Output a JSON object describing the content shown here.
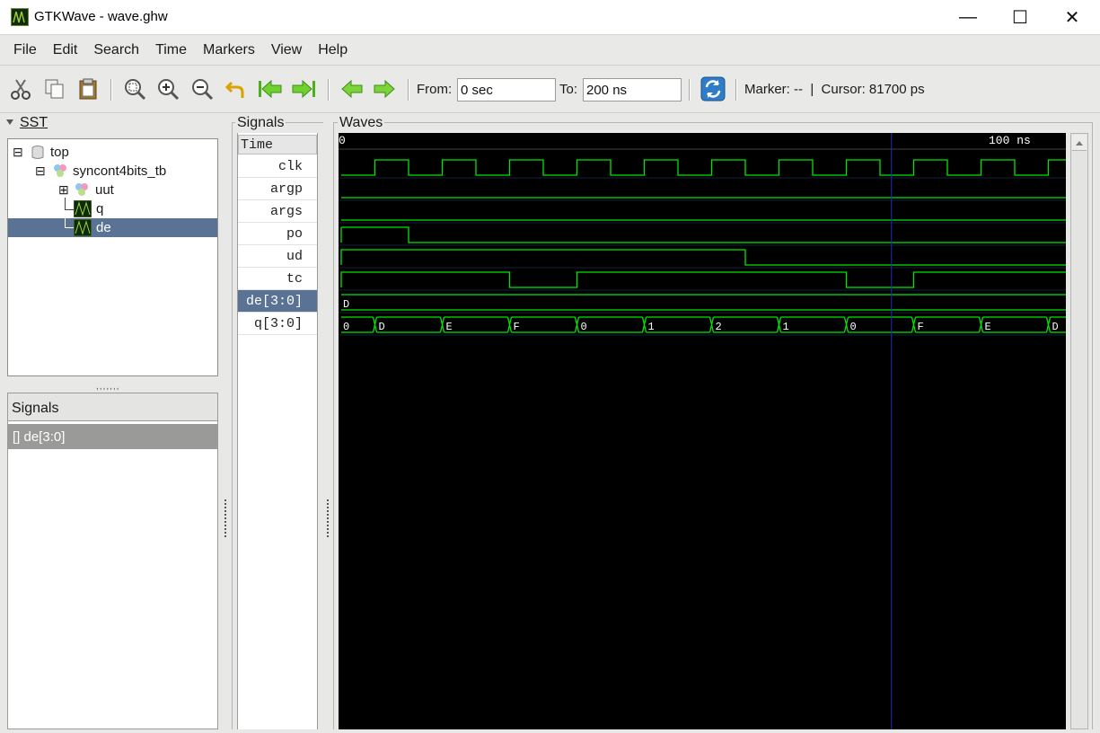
{
  "window": {
    "title": "GTKWave - wave.ghw",
    "controls": [
      "—",
      "☐",
      "✕"
    ]
  },
  "menu": [
    "File",
    "Edit",
    "Search",
    "Time",
    "Markers",
    "View",
    "Help"
  ],
  "toolbar": {
    "from_label": "From:",
    "from_value": "0 sec",
    "to_label": "To:",
    "to_value": "200 ns",
    "marker_text": "Marker: --  |  Cursor: 81700 ps",
    "icons": [
      "cut-icon",
      "copy-icon",
      "paste-icon",
      "zoom-fit-icon",
      "zoom-in-icon",
      "zoom-out-icon",
      "undo-zoom-icon",
      "zoom-to-start-icon",
      "zoom-to-end-icon",
      "previous-edge-icon",
      "next-edge-icon",
      "reload-icon"
    ]
  },
  "sst": {
    "title": "SST",
    "tree": [
      {
        "label": "top",
        "depth": 0,
        "expander": "⊟",
        "icon": "database-icon"
      },
      {
        "label": "syncont4bits_tb",
        "depth": 1,
        "expander": "⊟",
        "icon": "module-icon"
      },
      {
        "label": "uut",
        "depth": 2,
        "expander": "⊞",
        "icon": "module-icon"
      },
      {
        "label": "q",
        "depth": 2,
        "expander": "",
        "icon": "signal-icon"
      },
      {
        "label": "de",
        "depth": 2,
        "expander": "",
        "icon": "signal-icon",
        "selected": true
      }
    ]
  },
  "signals_panel": {
    "header": "Signals",
    "item": "[] de[3:0]"
  },
  "signals_column": {
    "title": "Signals",
    "time_header": "Time",
    "names": [
      "clk",
      "argp",
      "args",
      "po",
      "ud",
      "tc",
      "de[3:0]",
      "q[3:0]"
    ],
    "selected_index": 6
  },
  "waves": {
    "title": "Waves",
    "time_start_label": "0",
    "time_mark_label": "100 ns",
    "time_end_ns": 200,
    "cursor_ps": 81700,
    "visible_range_ns": [
      0,
      108
    ],
    "clk_period_ns": 10,
    "clk_first_rise_ns": 5,
    "po_high_until_ns": 10,
    "ud_high_until_ns": 60,
    "tc_low_intervals_ns": [
      [
        25,
        35
      ],
      [
        75,
        85
      ]
    ],
    "de_value": "D",
    "q_segments": [
      {
        "start": 0,
        "label": "0"
      },
      {
        "start": 5,
        "label": "D"
      },
      {
        "start": 15,
        "label": "E"
      },
      {
        "start": 25,
        "label": "F"
      },
      {
        "start": 35,
        "label": "0"
      },
      {
        "start": 45,
        "label": "1"
      },
      {
        "start": 55,
        "label": "2"
      },
      {
        "start": 65,
        "label": "1"
      },
      {
        "start": 75,
        "label": "0"
      },
      {
        "start": 85,
        "label": "F"
      },
      {
        "start": 95,
        "label": "E"
      },
      {
        "start": 105,
        "label": "D"
      }
    ],
    "colors": {
      "background": "#000000",
      "trace": "#00e600",
      "cursor": "#1f2cb8",
      "label": "#ffffff"
    }
  }
}
